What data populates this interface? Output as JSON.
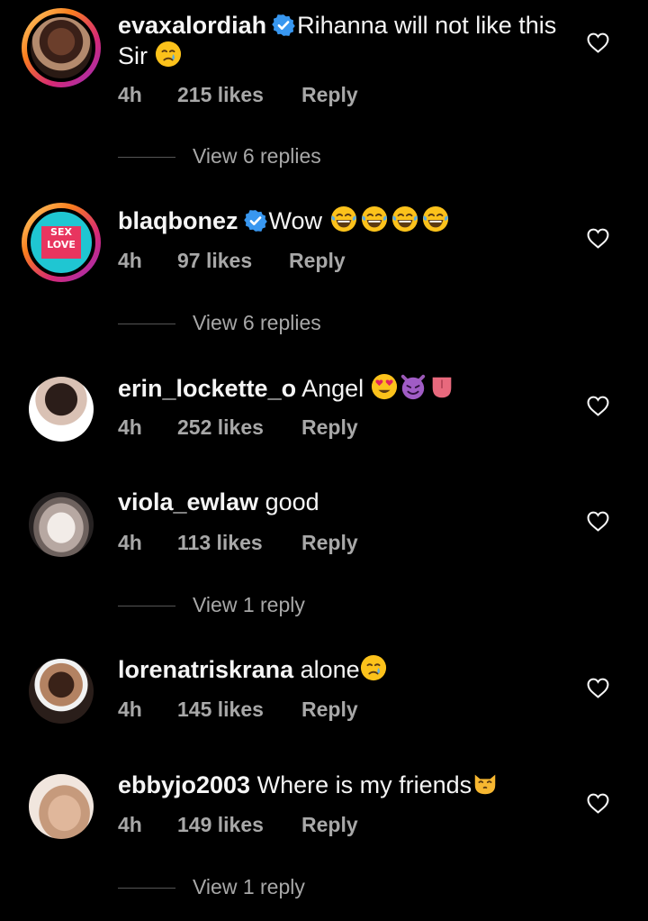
{
  "comments": [
    {
      "username": "evaxalordiah",
      "verified": true,
      "text": "Rihanna will not like this Sir",
      "emojis": [
        "crying-face"
      ],
      "time": "4h",
      "likes": "215 likes",
      "reply": "Reply",
      "view_replies": "View 6 replies"
    },
    {
      "username": "blaqbonez",
      "verified": true,
      "text": "Wow",
      "emojis": [
        "tears-of-joy",
        "tears-of-joy",
        "tears-of-joy",
        "tears-of-joy"
      ],
      "avatar_text": [
        "SEX",
        "LOVE"
      ],
      "time": "4h",
      "likes": "97 likes",
      "reply": "Reply",
      "view_replies": "View 6 replies"
    },
    {
      "username": "erin_lockette_o",
      "verified": false,
      "text": "Angel",
      "emojis": [
        "heart-eyes",
        "smiling-devil",
        "tongue"
      ],
      "time": "4h",
      "likes": "252 likes",
      "reply": "Reply"
    },
    {
      "username": "viola_ewlaw",
      "verified": false,
      "text": "good",
      "emojis": [],
      "time": "4h",
      "likes": "113 likes",
      "reply": "Reply",
      "view_replies": "View 1 reply"
    },
    {
      "username": "lorenatriskrana",
      "verified": false,
      "text": "alone",
      "emojis": [
        "crying-face"
      ],
      "time": "4h",
      "likes": "145 likes",
      "reply": "Reply"
    },
    {
      "username": "ebbyjo2003",
      "verified": false,
      "text": "Where is my friends",
      "emojis": [
        "kissing-cat"
      ],
      "time": "4h",
      "likes": "149 likes",
      "reply": "Reply",
      "view_replies": "View 1 reply"
    }
  ],
  "colors": {
    "background": "#000000",
    "text": "#f5f5f5",
    "secondary": "#a8a8a8",
    "verified": "#3897f0"
  }
}
